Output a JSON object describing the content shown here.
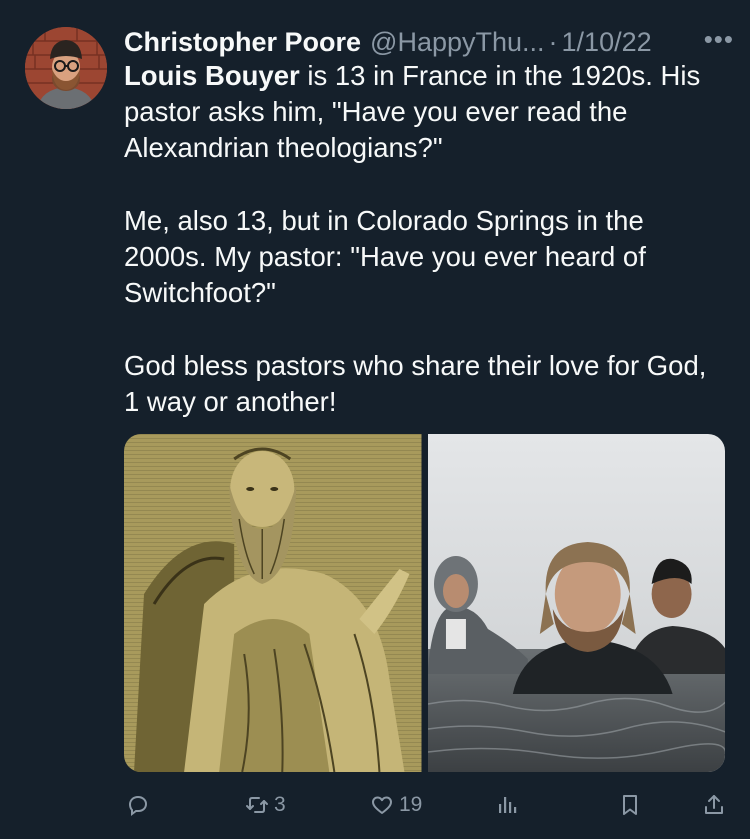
{
  "author": {
    "name": "Christopher Poore",
    "handle": "@HappyThu...",
    "separator": "·",
    "date": "1/10/22",
    "more_icon": "more-icon"
  },
  "tweet": {
    "p1_bold": "Louis Bouyer",
    "p1_rest": " is 13 in France in the 1920s. His pastor asks him, \"Have you ever read the Alexandrian theologians?\"",
    "p2": "Me, also 13, but in Colorado Springs in the 2000s. My pastor: \"Have you ever heard of Switchfoot?\"",
    "p3": "God bless pastors who share their love for God, 1 way or another!"
  },
  "media": [
    {
      "icon": "engraving-image"
    },
    {
      "icon": "band-photo-image"
    }
  ],
  "actions": {
    "reply": {
      "icon": "reply-icon"
    },
    "retweet": {
      "icon": "retweet-icon",
      "count": "3"
    },
    "like": {
      "icon": "heart-icon",
      "count": "19"
    },
    "views": {
      "icon": "views-icon"
    },
    "bookmark": {
      "icon": "bookmark-icon"
    },
    "share": {
      "icon": "share-icon"
    }
  },
  "colors": {
    "background": "#15202b",
    "text": "#f7f9f9",
    "secondary": "#8b98a5"
  }
}
